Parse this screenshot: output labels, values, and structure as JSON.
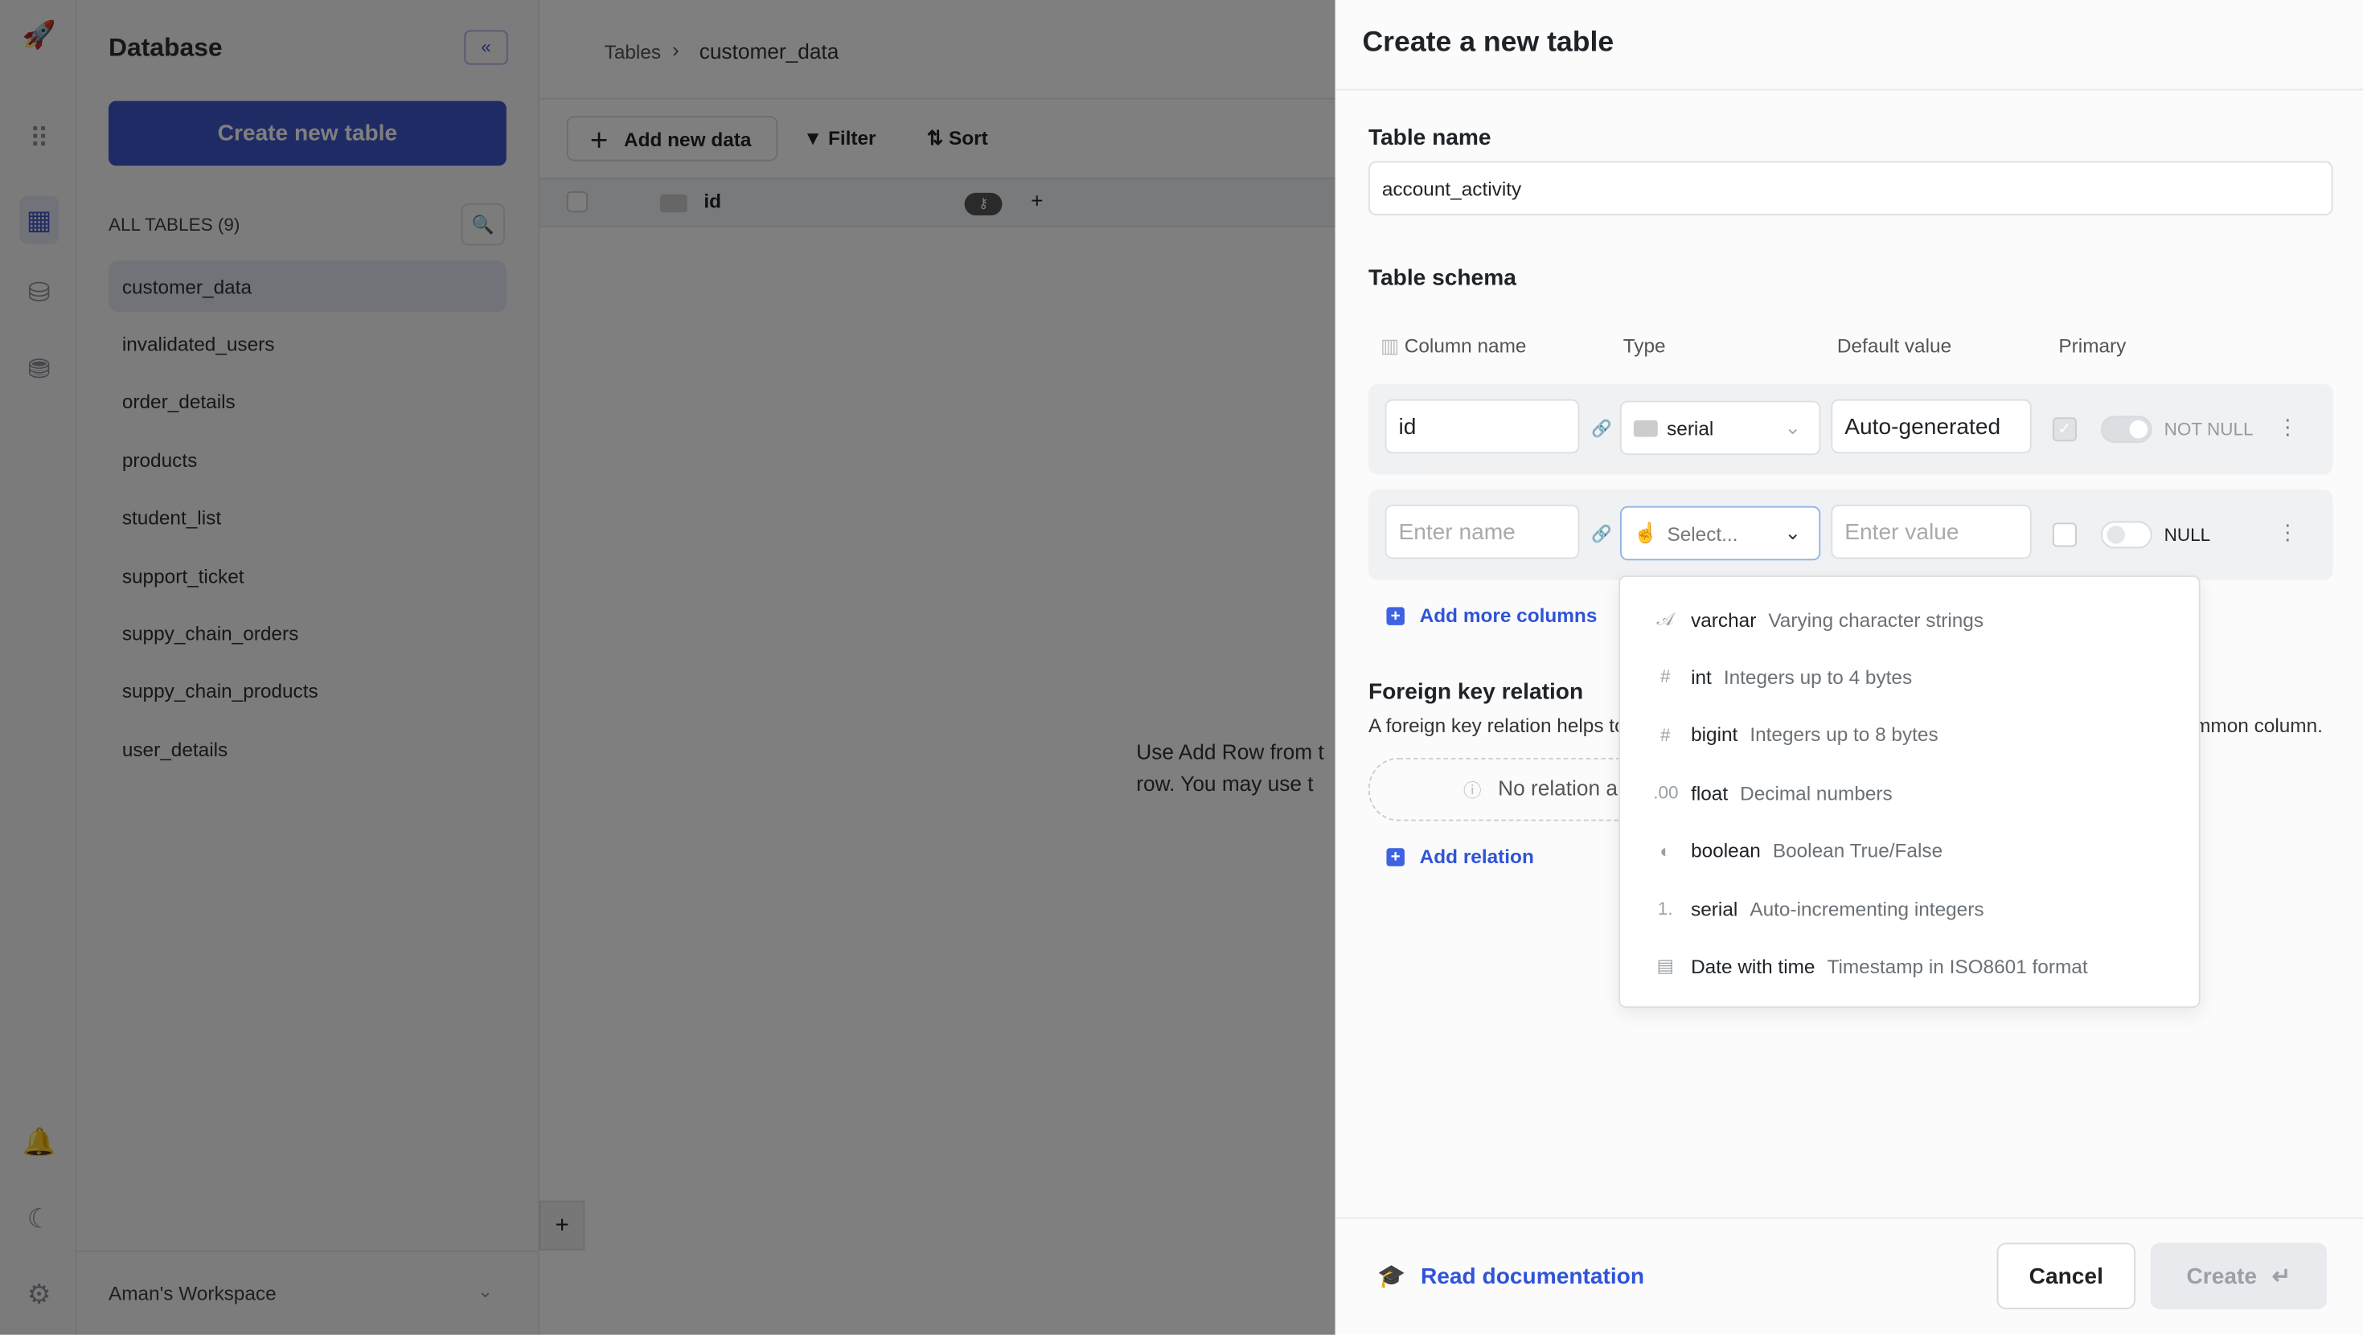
{
  "rail": {
    "icons": [
      "rocket-icon",
      "grid-icon",
      "table-icon",
      "database-icon",
      "storage-icon",
      "bell-icon",
      "moon-icon",
      "gear-icon"
    ]
  },
  "sidebar": {
    "title": "Database",
    "create_label": "Create new table",
    "all_tables_label": "ALL TABLES (9)",
    "tables": [
      "customer_data",
      "invalidated_users",
      "order_details",
      "products",
      "student_list",
      "support_ticket",
      "suppy_chain_orders",
      "suppy_chain_products",
      "user_details"
    ],
    "selected": "customer_data",
    "workspace": "Aman's Workspace"
  },
  "main": {
    "breadcrumb": [
      "Tables",
      "customer_data"
    ],
    "toolbar": {
      "add": "Add new data",
      "filter": "Filter",
      "sort": "Sort"
    },
    "column": "id",
    "empty_text_1": "Use Add Row from t",
    "empty_text_2": "row. You may use t"
  },
  "panel": {
    "title": "Create a new table",
    "table_name_label": "Table name",
    "table_name_value": "account_activity",
    "schema_label": "Table schema",
    "headers": {
      "column": "Column name",
      "type": "Type",
      "default": "Default value",
      "primary": "Primary"
    },
    "rows": [
      {
        "name": "id",
        "type": "serial",
        "default": "Auto-generated",
        "primary": true,
        "null_label": "NOT NULL"
      },
      {
        "name_placeholder": "Enter name",
        "type_placeholder": "Select...",
        "default_placeholder": "Enter value",
        "primary": false,
        "null_label": "NULL"
      }
    ],
    "add_columns": "Add more columns",
    "fk_title": "Foreign key relation",
    "fk_desc_start": "A foreign key relation helps to",
    "fk_desc_end": "mmon column.",
    "no_relation": "No relation a",
    "add_relation": "Add relation",
    "docs": "Read documentation",
    "cancel": "Cancel",
    "create": "Create"
  },
  "dropdown": {
    "options": [
      {
        "name": "varchar",
        "desc": "Varying character strings",
        "icon": "text-icon"
      },
      {
        "name": "int",
        "desc": "Integers up to 4 bytes",
        "icon": "hash-icon"
      },
      {
        "name": "bigint",
        "desc": "Integers up to 8 bytes",
        "icon": "hash-up-icon"
      },
      {
        "name": "float",
        "desc": "Decimal numbers",
        "icon": "decimal-icon"
      },
      {
        "name": "boolean",
        "desc": "Boolean True/False",
        "icon": "toggle-icon"
      },
      {
        "name": "serial",
        "desc": "Auto-incrementing integers",
        "icon": "serial-icon"
      },
      {
        "name": "Date with time",
        "desc": "Timestamp in ISO8601 format",
        "icon": "calendar-clock-icon"
      }
    ]
  },
  "colors": {
    "accent": "#2f54d8",
    "primary_button": "#3f57c8"
  }
}
